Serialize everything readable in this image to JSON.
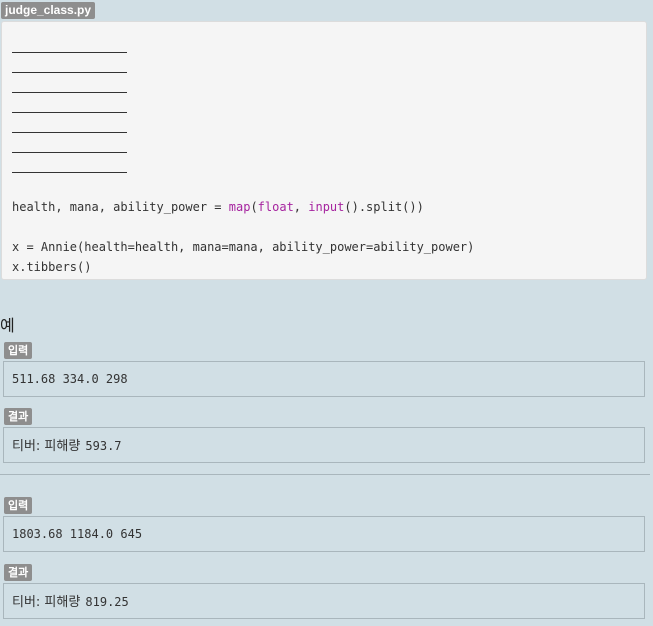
{
  "file_name": "judge_class.py",
  "code": {
    "blank_line_count": 7,
    "line_map": {
      "var": "health, mana, ability_power = ",
      "map_fn": "map",
      "open": "(",
      "float_fn": "float",
      "sep": ", ",
      "input_fn": "input",
      "rest": "().split())"
    },
    "line_annie": "x = Annie(health=health, mana=mana, ability_power=ability_power)",
    "line_tibbers": "x.tibbers()"
  },
  "examples_title": "예",
  "examples": [
    {
      "input_label": "입력",
      "input_value": "511.68 334.0 298",
      "output_label": "결과",
      "output_prefix": "티버: 피해량",
      "output_value": "593.7"
    },
    {
      "input_label": "입력",
      "input_value": "1803.68 1184.0 645",
      "output_label": "결과",
      "output_prefix": "티버: 피해량",
      "output_value": "819.25"
    }
  ],
  "colors": {
    "background": "#d1dfe5",
    "code_background": "#f5f5f5",
    "badge": "#8e8e8e",
    "keyword": "#a6249f"
  }
}
